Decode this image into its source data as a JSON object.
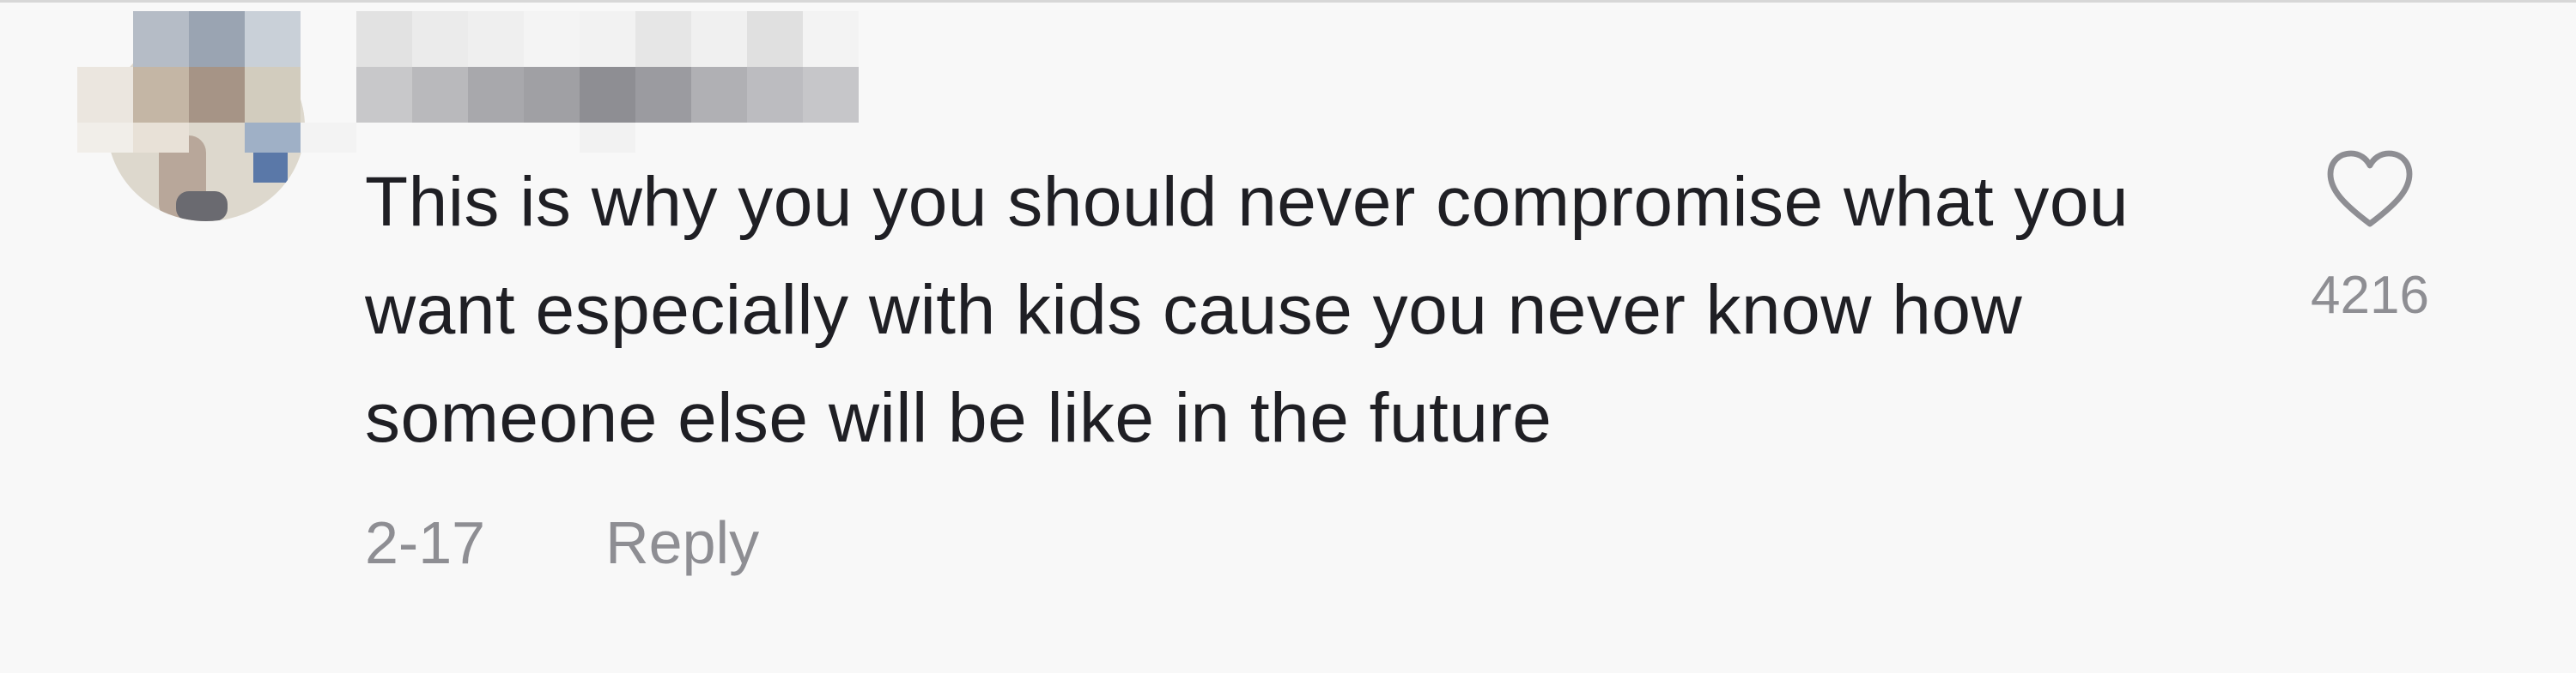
{
  "comment": {
    "text": "This is why you you should never compromise what you want especially with kids cause you never know how someone else will be like in the future",
    "date": "2-17",
    "reply_label": "Reply",
    "like_count": "4216",
    "like_icon": "heart-outline-icon"
  },
  "colors": {
    "background": "#f8f8f8",
    "text": "#1f1f24",
    "secondary": "#8e8e93"
  }
}
